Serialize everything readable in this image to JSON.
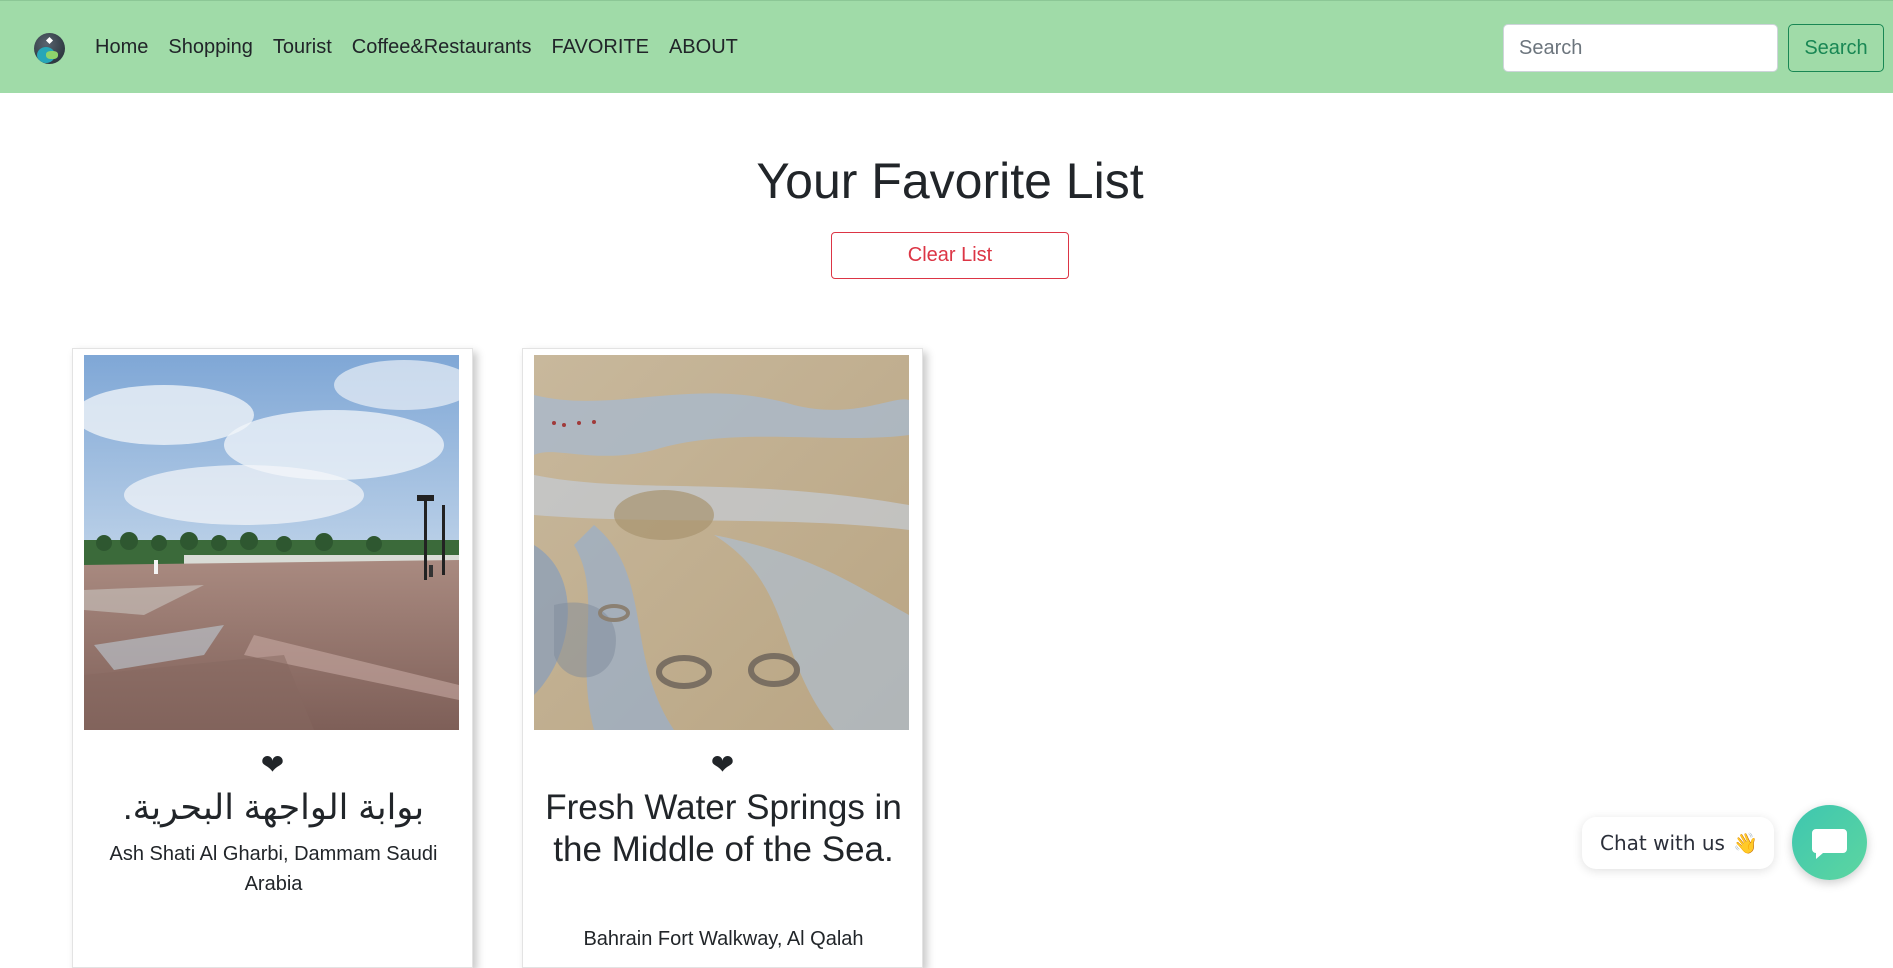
{
  "nav": {
    "links": [
      "Home",
      "Shopping",
      "Tourist",
      "Coffee&Restaurants",
      "FAVORITE",
      "ABOUT"
    ],
    "search_placeholder": "Search",
    "search_button": "Search"
  },
  "main": {
    "title": "Your Favorite List",
    "clear_button": "Clear List"
  },
  "cards": [
    {
      "title": "بوابة الواجهة البحرية.",
      "location": "Ash Shati Al Gharbi, Dammam Saudi Arabia",
      "favorite": true
    },
    {
      "title": "Fresh Water Springs in the Middle of the Sea.",
      "location": "Bahrain Fort Walkway, Al Qalah",
      "favorite": true
    }
  ],
  "chat": {
    "label": "Chat with us",
    "wave": "👋"
  },
  "colors": {
    "navbar": "#a0dba8",
    "success": "#198754",
    "danger": "#dc3545",
    "chat_gradient": "#3ec6b0"
  }
}
